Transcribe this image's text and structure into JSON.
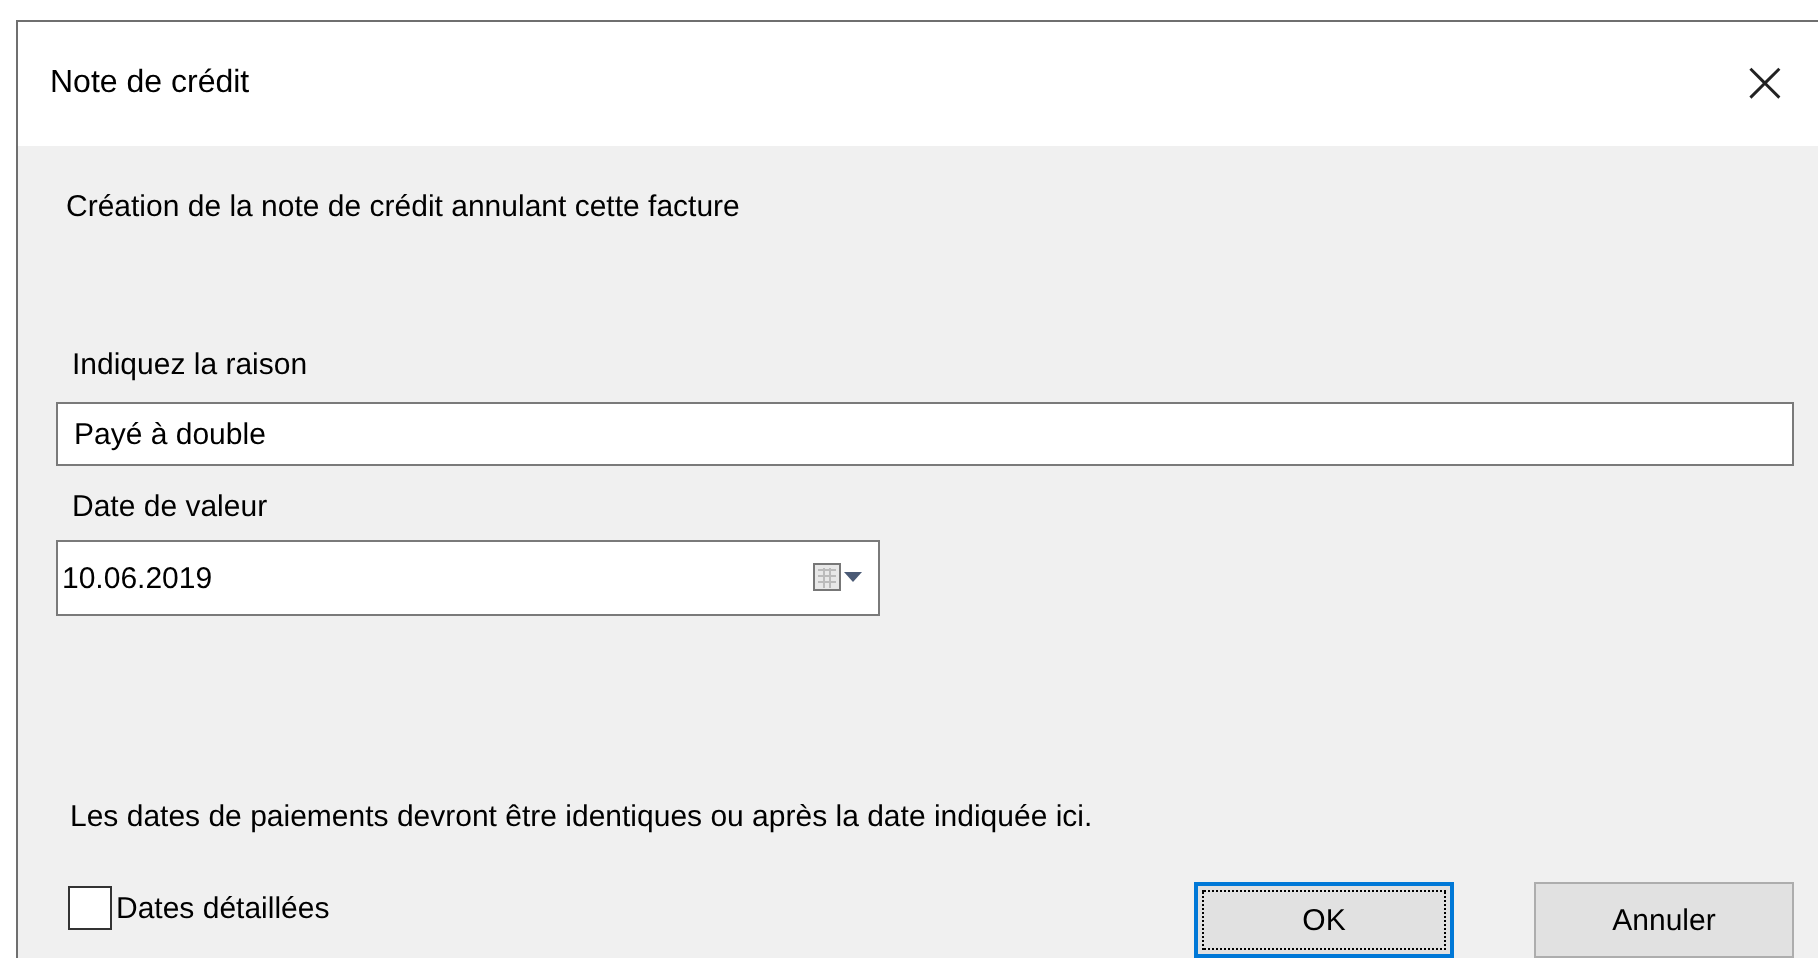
{
  "window": {
    "title": "Note de crédit",
    "close": "×"
  },
  "description": "Création de la note de crédit annulant cette facture",
  "reason": {
    "label": "Indiquez la raison",
    "value": "Payé à double"
  },
  "value_date": {
    "label": "Date de valeur",
    "value": "10.06.2019"
  },
  "info": "Les dates de paiements devront être identiques ou après la date indiquée ici.",
  "detailed_dates": {
    "label": "Dates détaillées",
    "checked": false
  },
  "buttons": [
    {
      "label": "OK",
      "selected": true
    },
    {
      "label": "Annuler",
      "selected": false
    }
  ]
}
